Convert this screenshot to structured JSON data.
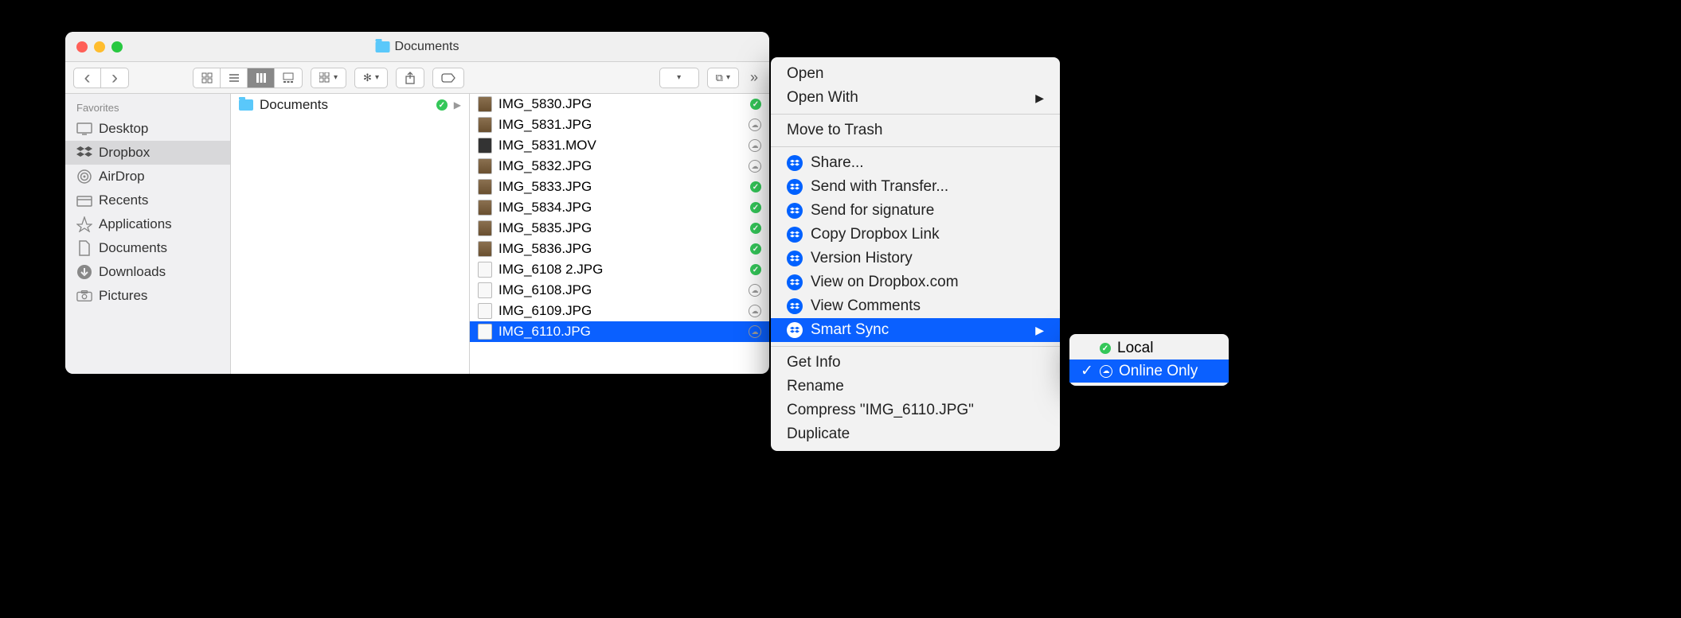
{
  "window": {
    "title": "Documents"
  },
  "sidebar": {
    "header": "Favorites",
    "items": [
      {
        "label": "Desktop",
        "icon": "desktop"
      },
      {
        "label": "Dropbox",
        "icon": "dropbox",
        "selected": true
      },
      {
        "label": "AirDrop",
        "icon": "airdrop"
      },
      {
        "label": "Recents",
        "icon": "recents"
      },
      {
        "label": "Applications",
        "icon": "apps"
      },
      {
        "label": "Documents",
        "icon": "docs"
      },
      {
        "label": "Downloads",
        "icon": "downloads"
      },
      {
        "label": "Pictures",
        "icon": "pictures"
      }
    ]
  },
  "column1": {
    "folder": "Documents",
    "status": "synced"
  },
  "files": [
    {
      "name": "IMG_5830.JPG",
      "status": "synced",
      "kind": "img"
    },
    {
      "name": "IMG_5831.JPG",
      "status": "cloud",
      "kind": "img"
    },
    {
      "name": "IMG_5831.MOV",
      "status": "cloud",
      "kind": "mov"
    },
    {
      "name": "IMG_5832.JPG",
      "status": "cloud",
      "kind": "img"
    },
    {
      "name": "IMG_5833.JPG",
      "status": "synced",
      "kind": "img"
    },
    {
      "name": "IMG_5834.JPG",
      "status": "synced",
      "kind": "img"
    },
    {
      "name": "IMG_5835.JPG",
      "status": "synced",
      "kind": "img"
    },
    {
      "name": "IMG_5836.JPG",
      "status": "synced",
      "kind": "img"
    },
    {
      "name": "IMG_6108 2.JPG",
      "status": "synced",
      "kind": "blank"
    },
    {
      "name": "IMG_6108.JPG",
      "status": "cloud",
      "kind": "blank"
    },
    {
      "name": "IMG_6109.JPG",
      "status": "cloud",
      "kind": "blank"
    },
    {
      "name": "IMG_6110.JPG",
      "status": "cloud",
      "kind": "blank",
      "selected": true
    }
  ],
  "context_menu": {
    "items": [
      {
        "label": "Open"
      },
      {
        "label": "Open With",
        "submenu": true
      },
      {
        "sep": true
      },
      {
        "label": "Move to Trash"
      },
      {
        "sep": true
      },
      {
        "label": "Share...",
        "dropbox": true
      },
      {
        "label": "Send with Transfer...",
        "dropbox": true
      },
      {
        "label": "Send for signature",
        "dropbox": true
      },
      {
        "label": "Copy Dropbox Link",
        "dropbox": true
      },
      {
        "label": "Version History",
        "dropbox": true
      },
      {
        "label": "View on Dropbox.com",
        "dropbox": true
      },
      {
        "label": "View Comments",
        "dropbox": true
      },
      {
        "label": "Smart Sync",
        "dropbox": true,
        "submenu": true,
        "highlighted": true
      },
      {
        "sep": true
      },
      {
        "label": "Get Info"
      },
      {
        "label": "Rename"
      },
      {
        "label": "Compress \"IMG_6110.JPG\""
      },
      {
        "label": "Duplicate"
      }
    ]
  },
  "smart_sync_submenu": {
    "items": [
      {
        "label": "Local",
        "icon": "synced"
      },
      {
        "label": "Online Only",
        "icon": "cloud",
        "checked": true,
        "highlighted": true
      }
    ]
  }
}
